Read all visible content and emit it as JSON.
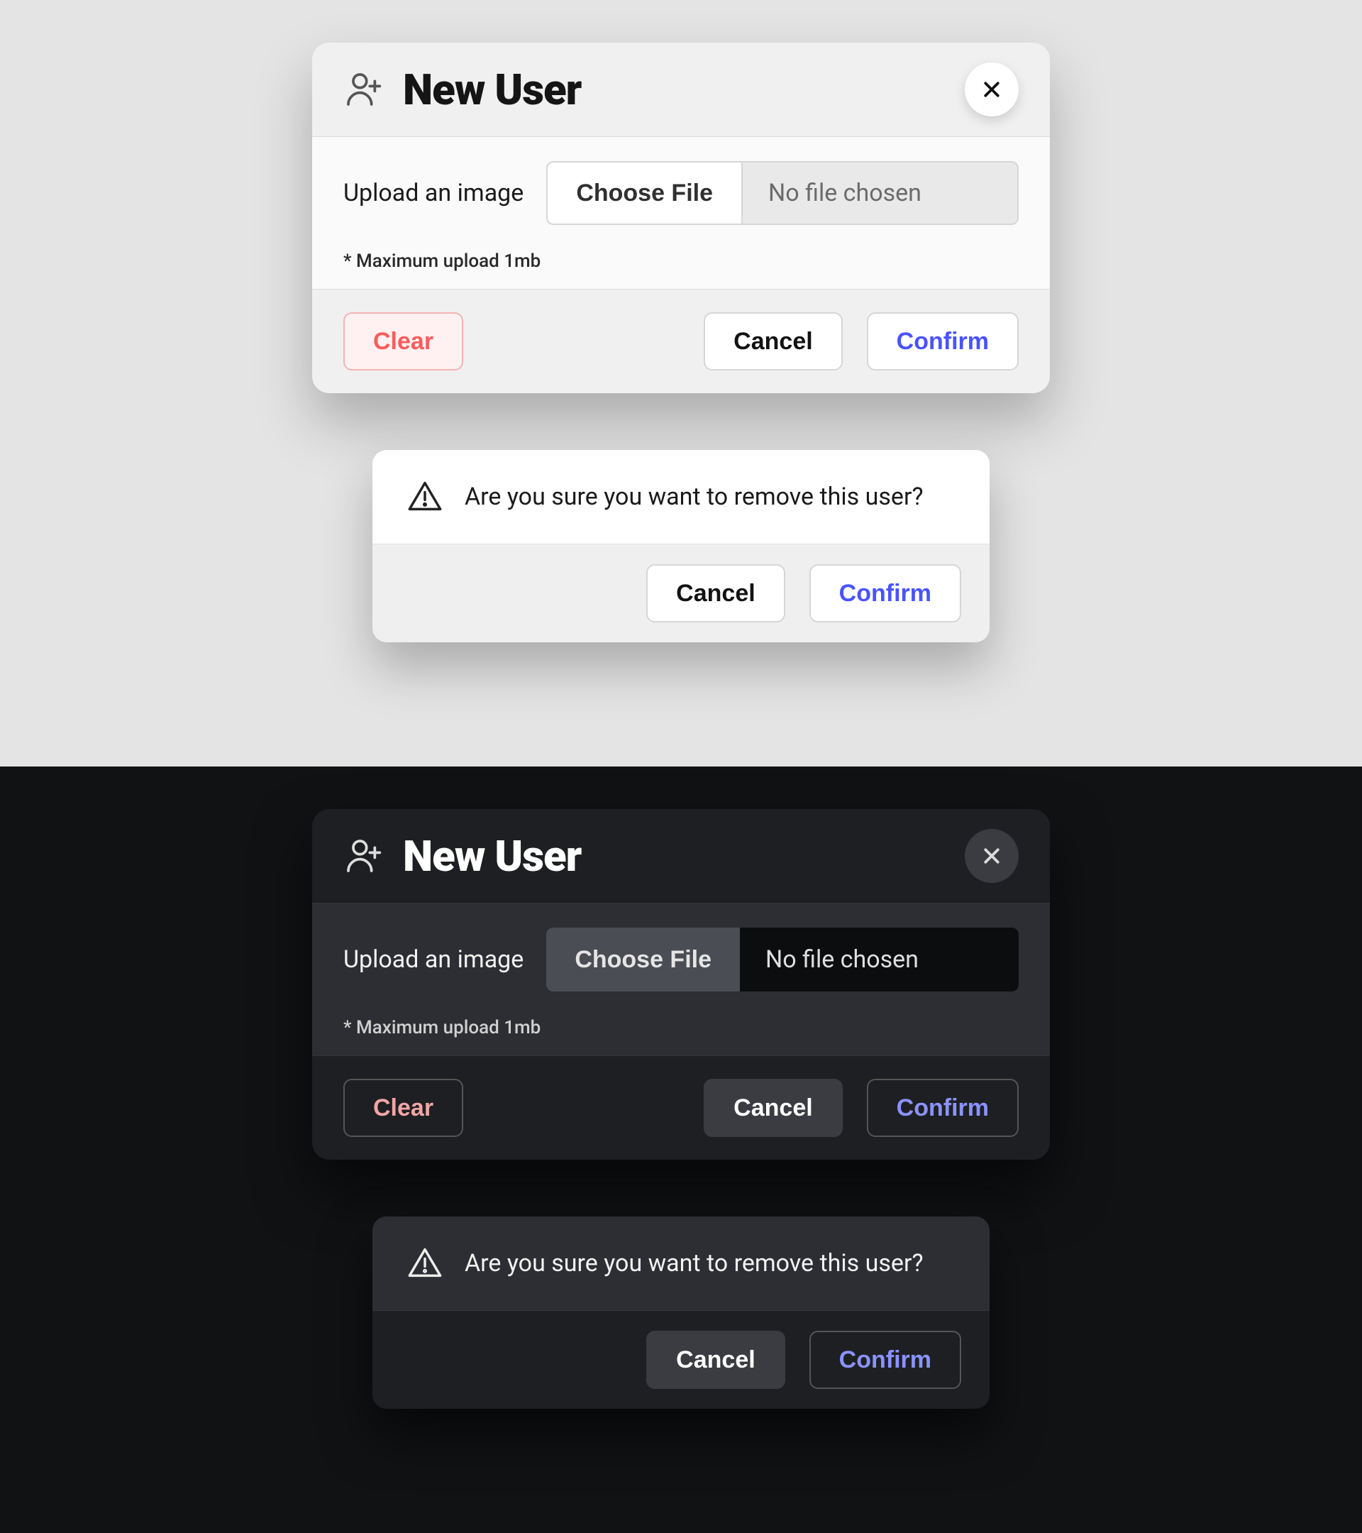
{
  "modal": {
    "title": "New User",
    "upload_label": "Upload an image",
    "choose_file_label": "Choose File",
    "no_file_text": "No file chosen",
    "hint": "* Maximum upload 1mb",
    "clear_label": "Clear",
    "cancel_label": "Cancel",
    "confirm_label": "Confirm"
  },
  "dialog": {
    "message": "Are you sure you want to remove this user?",
    "cancel_label": "Cancel",
    "confirm_label": "Confirm"
  }
}
